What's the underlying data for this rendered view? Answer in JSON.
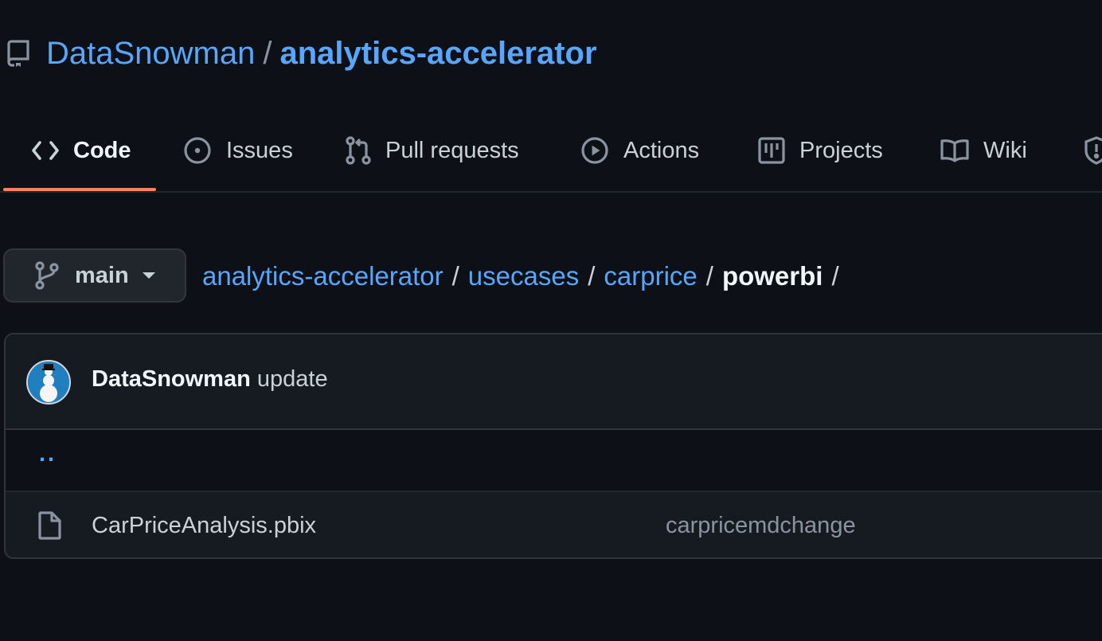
{
  "repo": {
    "owner": "DataSnowman",
    "separator": "/",
    "name": "analytics-accelerator",
    "icon": "repo-icon"
  },
  "tabs": [
    {
      "label": "Code",
      "icon": "code-icon",
      "selected": true
    },
    {
      "label": "Issues",
      "icon": "issue-icon"
    },
    {
      "label": "Pull requests",
      "icon": "pull-request-icon"
    },
    {
      "label": "Actions",
      "icon": "play-icon"
    },
    {
      "label": "Projects",
      "icon": "project-icon"
    },
    {
      "label": "Wiki",
      "icon": "book-icon"
    },
    {
      "label": "",
      "icon": "shield-icon"
    }
  ],
  "branch": {
    "name": "main",
    "icon": "git-branch-icon"
  },
  "breadcrumb": {
    "parts": [
      "analytics-accelerator",
      "usecases",
      "carprice"
    ],
    "current": "powerbi",
    "separator": "/"
  },
  "latest_commit": {
    "author": "DataSnowman",
    "message": "update"
  },
  "parent_dir": "..",
  "files": [
    {
      "name": "CarPriceAnalysis.pbix",
      "commit_message": "carpricemdchange",
      "icon": "file-icon"
    }
  ],
  "colors": {
    "background": "#0d1117",
    "link": "#58a6ff",
    "tab_underline": "#f78166",
    "border": "#30363d"
  }
}
